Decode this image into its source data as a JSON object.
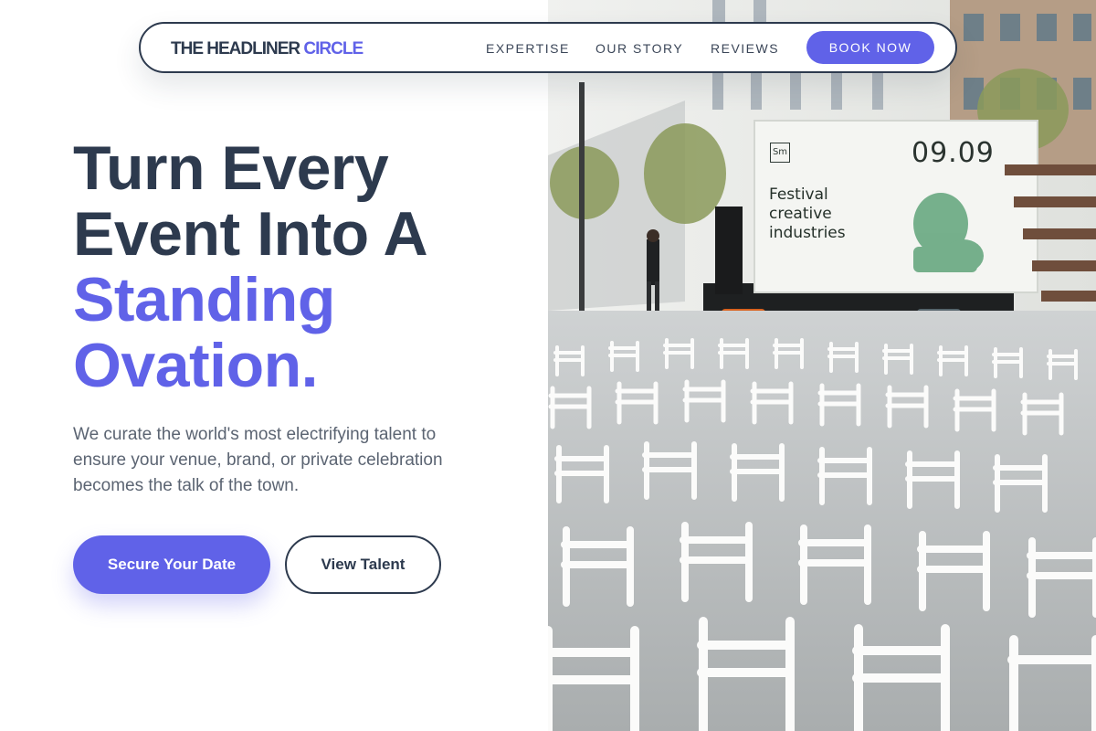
{
  "nav": {
    "brand_main": "THE HEADLINER",
    "brand_accent": "CIRCLE",
    "links": [
      "EXPERTISE",
      "OUR STORY",
      "REVIEWS"
    ],
    "cta_label": "BOOK NOW"
  },
  "hero": {
    "title_line1": "Turn Every",
    "title_line2": "Event Into A",
    "title_line3": "Standing",
    "title_line4": "Ovation.",
    "subtitle": "We curate the world's most electrifying talent to ensure your venue, brand, or private celebration becomes the talk of the town.",
    "primary_cta": "Secure Your Date",
    "secondary_cta": "View Talent"
  },
  "photo": {
    "screen_logo": "Sm",
    "screen_date": "09.09",
    "screen_title": "Festival creative industries"
  },
  "colors": {
    "accent": "#6062e8",
    "navy": "#2d3a4e",
    "body_text": "#5b6472"
  }
}
